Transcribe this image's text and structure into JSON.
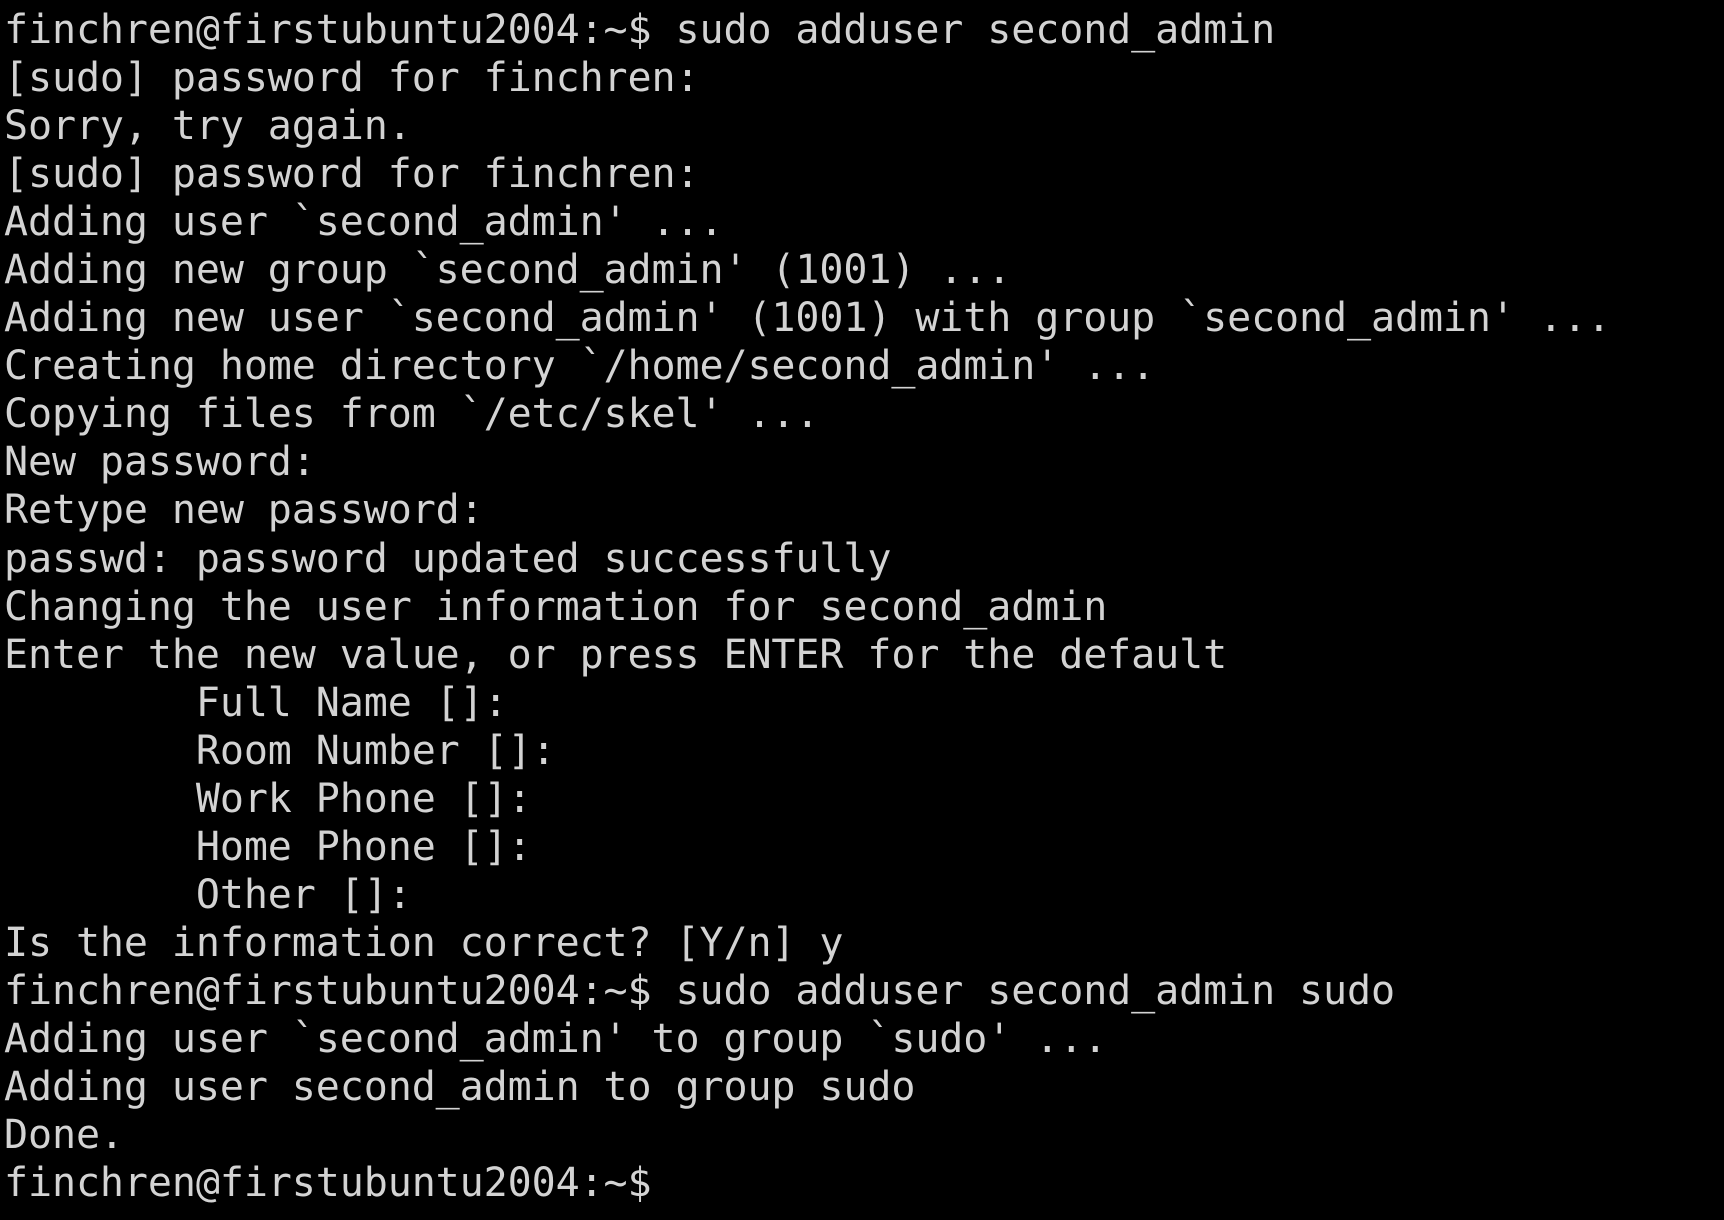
{
  "terminal": {
    "background": "#000000",
    "foreground": "#d3d3d3",
    "lines": [
      "finchren@firstubuntu2004:~$ sudo adduser second_admin",
      "[sudo] password for finchren:",
      "Sorry, try again.",
      "[sudo] password for finchren:",
      "Adding user `second_admin' ...",
      "Adding new group `second_admin' (1001) ...",
      "Adding new user `second_admin' (1001) with group `second_admin' ...",
      "Creating home directory `/home/second_admin' ...",
      "Copying files from `/etc/skel' ...",
      "New password:",
      "Retype new password:",
      "passwd: password updated successfully",
      "Changing the user information for second_admin",
      "Enter the new value, or press ENTER for the default",
      "        Full Name []:",
      "        Room Number []:",
      "        Work Phone []:",
      "        Home Phone []:",
      "        Other []:",
      "Is the information correct? [Y/n] y",
      "finchren@firstubuntu2004:~$ sudo adduser second_admin sudo",
      "Adding user `second_admin' to group `sudo' ...",
      "Adding user second_admin to group sudo",
      "Done.",
      "finchren@firstubuntu2004:~$"
    ]
  }
}
